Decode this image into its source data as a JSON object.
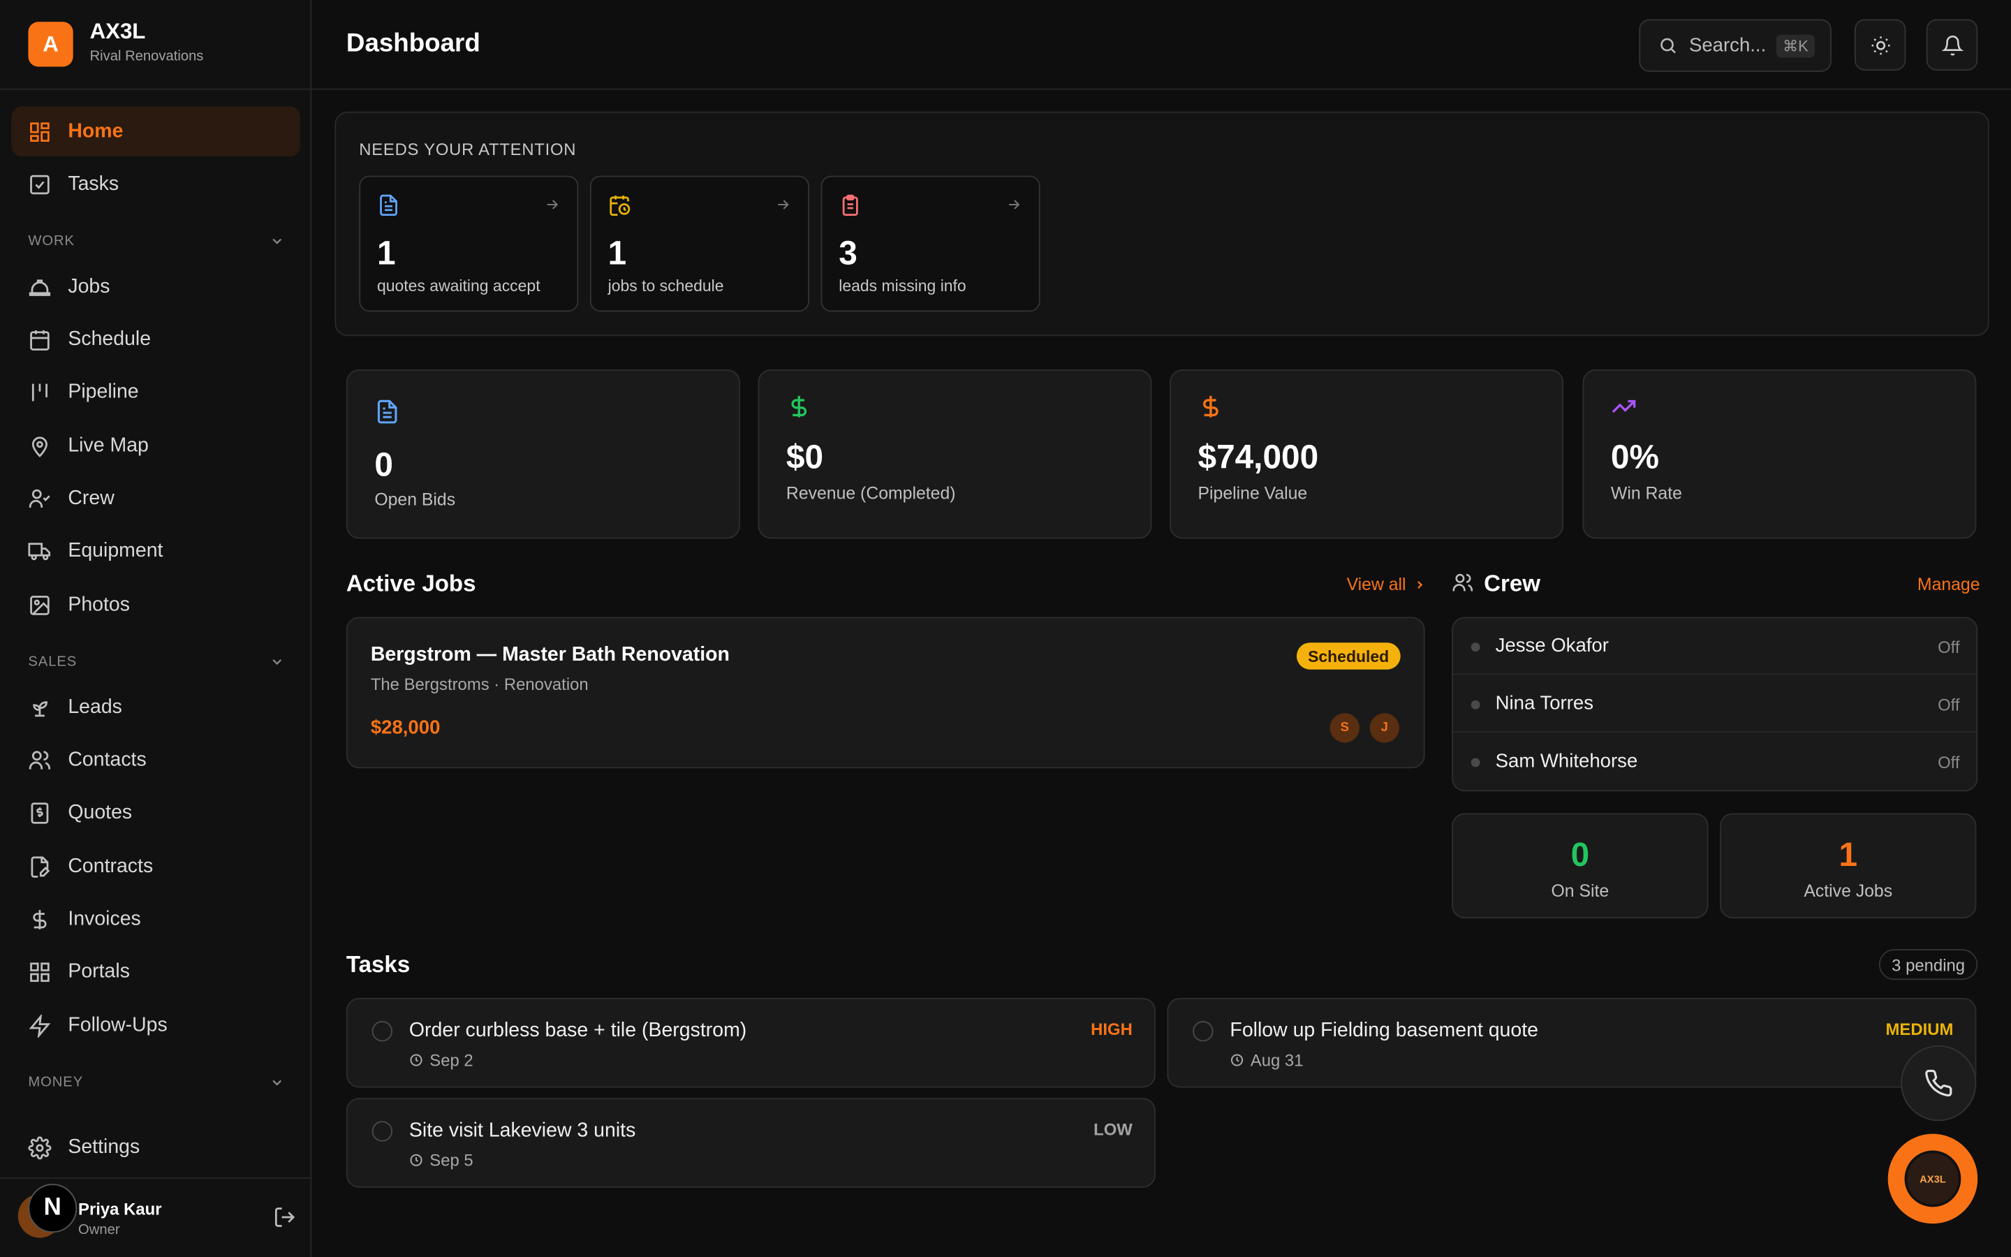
{
  "brand": {
    "name": "AX3L",
    "logo_letter": "A",
    "subtitle": "Rival Renovations"
  },
  "nav": {
    "home": "Home",
    "tasks": "Tasks",
    "work_section": "WORK",
    "jobs": "Jobs",
    "schedule": "Schedule",
    "pipeline": "Pipeline",
    "live_map": "Live Map",
    "crew": "Crew",
    "equipment": "Equipment",
    "photos": "Photos",
    "sales_section": "SALES",
    "leads": "Leads",
    "contacts": "Contacts",
    "quotes": "Quotes",
    "contracts": "Contracts",
    "invoices": "Invoices",
    "portals": "Portals",
    "follow_ups": "Follow-Ups",
    "money_section": "MONEY",
    "settings": "Settings"
  },
  "user": {
    "name": "Priya Kaur",
    "role": "Owner",
    "badge_letter": "N"
  },
  "header": {
    "title": "Dashboard",
    "search_placeholder": "Search...",
    "shortcut": "⌘K"
  },
  "attention": {
    "title": "NEEDS YOUR ATTENTION",
    "cards": [
      {
        "count": "1",
        "label": "quotes awaiting accept",
        "color": "#60a5fa"
      },
      {
        "count": "1",
        "label": "jobs to schedule",
        "color": "#eab308"
      },
      {
        "count": "3",
        "label": "leads missing info",
        "color": "#f87171"
      }
    ]
  },
  "stats": [
    {
      "value": "0",
      "label": "Open Bids",
      "color": "#60a5fa"
    },
    {
      "value": "$0",
      "label": "Revenue (Completed)",
      "color": "#22c55e"
    },
    {
      "value": "$74,000",
      "label": "Pipeline Value",
      "color": "#f97316"
    },
    {
      "value": "0%",
      "label": "Win Rate",
      "color": "#a855f7"
    }
  ],
  "active_jobs": {
    "title": "Active Jobs",
    "view_all": "View all",
    "jobs": [
      {
        "title": "Bergstrom — Master Bath Renovation",
        "subtitle": "The Bergstroms · Renovation",
        "amount": "$28,000",
        "status": "Scheduled",
        "avatars": [
          "S",
          "J"
        ]
      }
    ]
  },
  "crew": {
    "title": "Crew",
    "manage": "Manage",
    "members": [
      {
        "name": "Jesse Okafor",
        "status": "Off"
      },
      {
        "name": "Nina Torres",
        "status": "Off"
      },
      {
        "name": "Sam Whitehorse",
        "status": "Off"
      }
    ],
    "on_site": {
      "value": "0",
      "label": "On Site",
      "color": "#22c55e"
    },
    "active_jobs": {
      "value": "1",
      "label": "Active Jobs",
      "color": "#f97316"
    }
  },
  "tasks": {
    "title": "Tasks",
    "pending": "3 pending",
    "items": [
      {
        "title": "Order curbless base + tile (Bergstrom)",
        "date": "Sep 2",
        "priority": "HIGH",
        "color": "#f97316"
      },
      {
        "title": "Follow up Fielding basement quote",
        "date": "Aug 31",
        "priority": "MEDIUM",
        "color": "#eab308"
      },
      {
        "title": "Site visit Lakeview 3 units",
        "date": "Sep 5",
        "priority": "LOW",
        "color": "#a3a3a3"
      }
    ]
  },
  "fab": {
    "logo_text": "AX3L"
  },
  "colors": {
    "accent": "#f97316",
    "background": "#0e0e0e",
    "card": "#1a1a1a"
  }
}
